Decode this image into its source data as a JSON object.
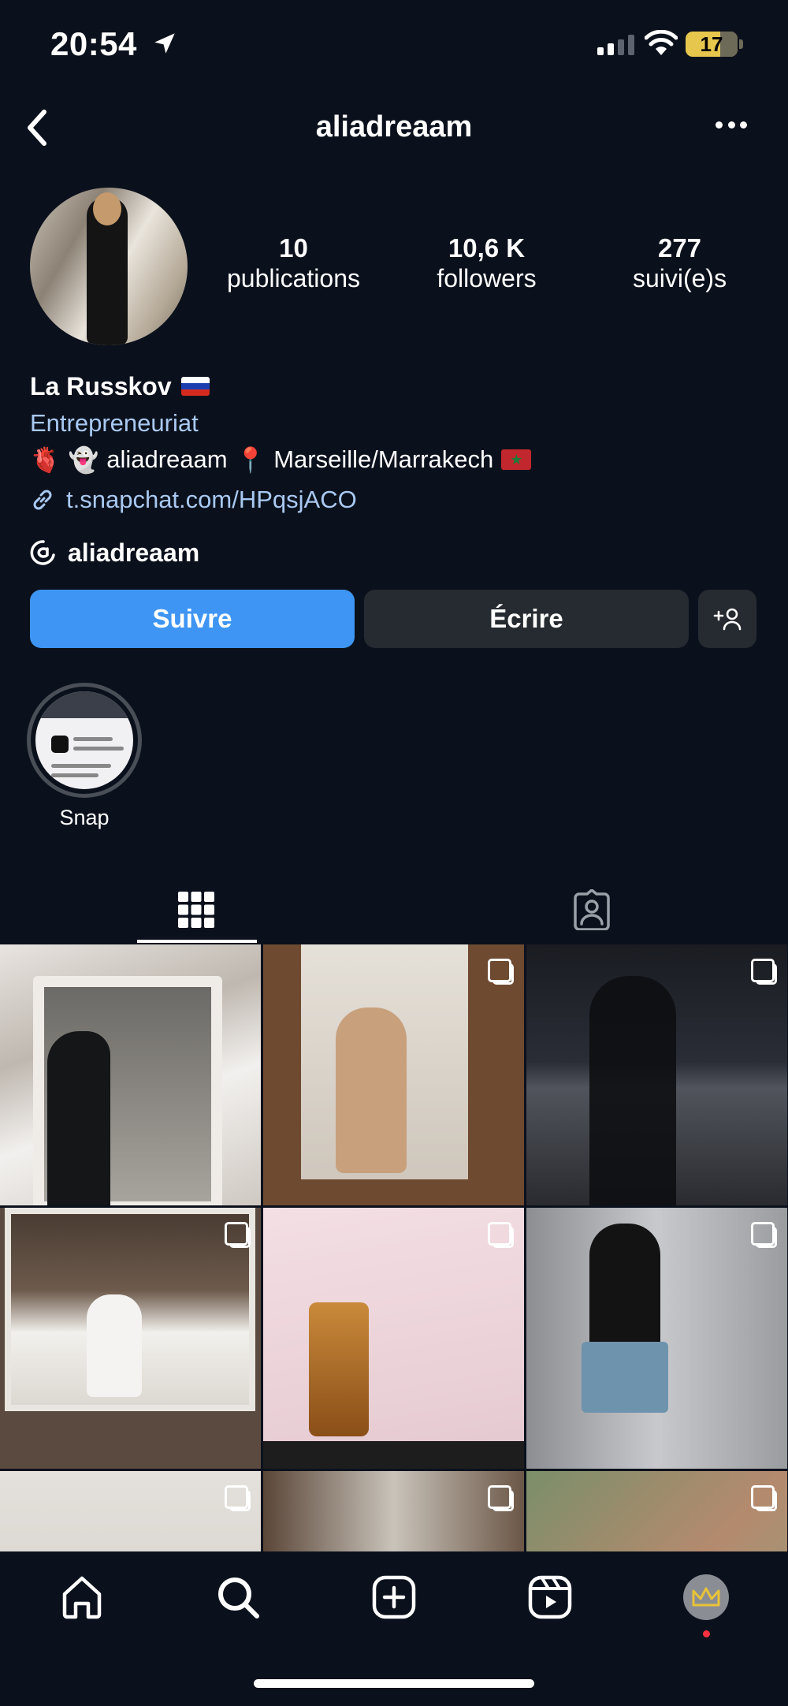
{
  "status_bar": {
    "time": "20:54",
    "battery": "17"
  },
  "header": {
    "username": "aliadreaam"
  },
  "stats": [
    {
      "number": "10",
      "label": "publications"
    },
    {
      "number": "10,6 K",
      "label": "followers"
    },
    {
      "number": "277",
      "label": "suivi(e)s"
    }
  ],
  "bio": {
    "name": "La Russkov",
    "category": "Entrepreneuriat",
    "line_emoji_heart": "🫀",
    "line_emoji_ghost": "👻",
    "line_handle": "aliadreaam",
    "line_pin": "📍",
    "line_location": "Marseille/Marrakech",
    "link": "t.snapchat.com/HPqsjACO",
    "threads_handle": "aliadreaam"
  },
  "actions": {
    "follow": "Suivre",
    "message": "Écrire"
  },
  "highlights": [
    {
      "label": "Snap"
    }
  ],
  "colors": {
    "background": "#0b111c",
    "accent": "#3e95f3",
    "link": "#a9c9f2",
    "button_dark": "#262a31"
  }
}
